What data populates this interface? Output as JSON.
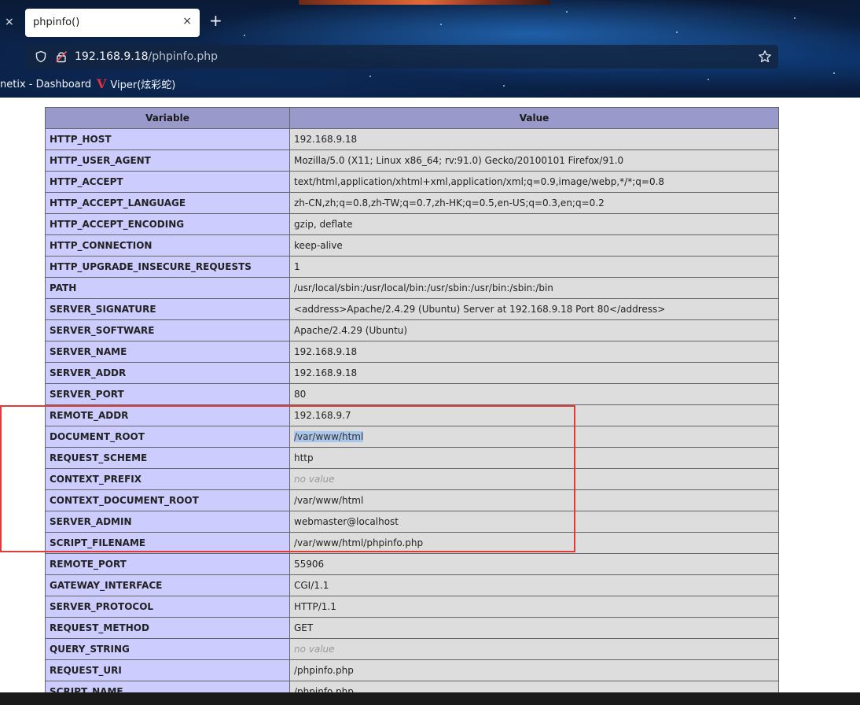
{
  "browser": {
    "tab_title": "phpinfo()",
    "close_glyph": "×",
    "new_tab_glyph": "+",
    "url_host": "192.168.9.18",
    "url_path": "/phpinfo.php",
    "bookmarks": [
      {
        "label": "netix - Dashboard"
      },
      {
        "label": "Viper(炫彩蛇)",
        "icon": "V"
      }
    ]
  },
  "table": {
    "headers": {
      "variable": "Variable",
      "value": "Value"
    },
    "rows": [
      {
        "name": "HTTP_HOST",
        "value": "192.168.9.18"
      },
      {
        "name": "HTTP_USER_AGENT",
        "value": "Mozilla/5.0 (X11; Linux x86_64; rv:91.0) Gecko/20100101 Firefox/91.0"
      },
      {
        "name": "HTTP_ACCEPT",
        "value": "text/html,application/xhtml+xml,application/xml;q=0.9,image/webp,*/*;q=0.8"
      },
      {
        "name": "HTTP_ACCEPT_LANGUAGE",
        "value": "zh-CN,zh;q=0.8,zh-TW;q=0.7,zh-HK;q=0.5,en-US;q=0.3,en;q=0.2"
      },
      {
        "name": "HTTP_ACCEPT_ENCODING",
        "value": "gzip, deflate"
      },
      {
        "name": "HTTP_CONNECTION",
        "value": "keep-alive"
      },
      {
        "name": "HTTP_UPGRADE_INSECURE_REQUESTS",
        "value": "1"
      },
      {
        "name": "PATH",
        "value": "/usr/local/sbin:/usr/local/bin:/usr/sbin:/usr/bin:/sbin:/bin"
      },
      {
        "name": "SERVER_SIGNATURE",
        "value": "<address>Apache/2.4.29 (Ubuntu) Server at 192.168.9.18 Port 80</address>"
      },
      {
        "name": "SERVER_SOFTWARE",
        "value": "Apache/2.4.29 (Ubuntu)"
      },
      {
        "name": "SERVER_NAME",
        "value": "192.168.9.18"
      },
      {
        "name": "SERVER_ADDR",
        "value": "192.168.9.18"
      },
      {
        "name": "SERVER_PORT",
        "value": "80"
      },
      {
        "name": "REMOTE_ADDR",
        "value": "192.168.9.7"
      },
      {
        "name": "DOCUMENT_ROOT",
        "value": "/var/www/html",
        "selected": true
      },
      {
        "name": "REQUEST_SCHEME",
        "value": "http"
      },
      {
        "name": "CONTEXT_PREFIX",
        "value": "no value",
        "novalue": true
      },
      {
        "name": "CONTEXT_DOCUMENT_ROOT",
        "value": "/var/www/html"
      },
      {
        "name": "SERVER_ADMIN",
        "value": "webmaster@localhost"
      },
      {
        "name": "SCRIPT_FILENAME",
        "value": "/var/www/html/phpinfo.php"
      },
      {
        "name": "REMOTE_PORT",
        "value": "55906"
      },
      {
        "name": "GATEWAY_INTERFACE",
        "value": "CGI/1.1"
      },
      {
        "name": "SERVER_PROTOCOL",
        "value": "HTTP/1.1"
      },
      {
        "name": "REQUEST_METHOD",
        "value": "GET"
      },
      {
        "name": "QUERY_STRING",
        "value": "no value",
        "novalue": true
      },
      {
        "name": "REQUEST_URI",
        "value": "/phpinfo.php"
      },
      {
        "name": "SCRIPT_NAME",
        "value": "/phpinfo.php"
      }
    ]
  },
  "colors": {
    "header_bg": "#9999cc",
    "name_cell_bg": "#ccccff",
    "value_cell_bg": "#dddddd",
    "highlight_border": "#e03b3b",
    "selection_bg": "#a9c5ea"
  }
}
